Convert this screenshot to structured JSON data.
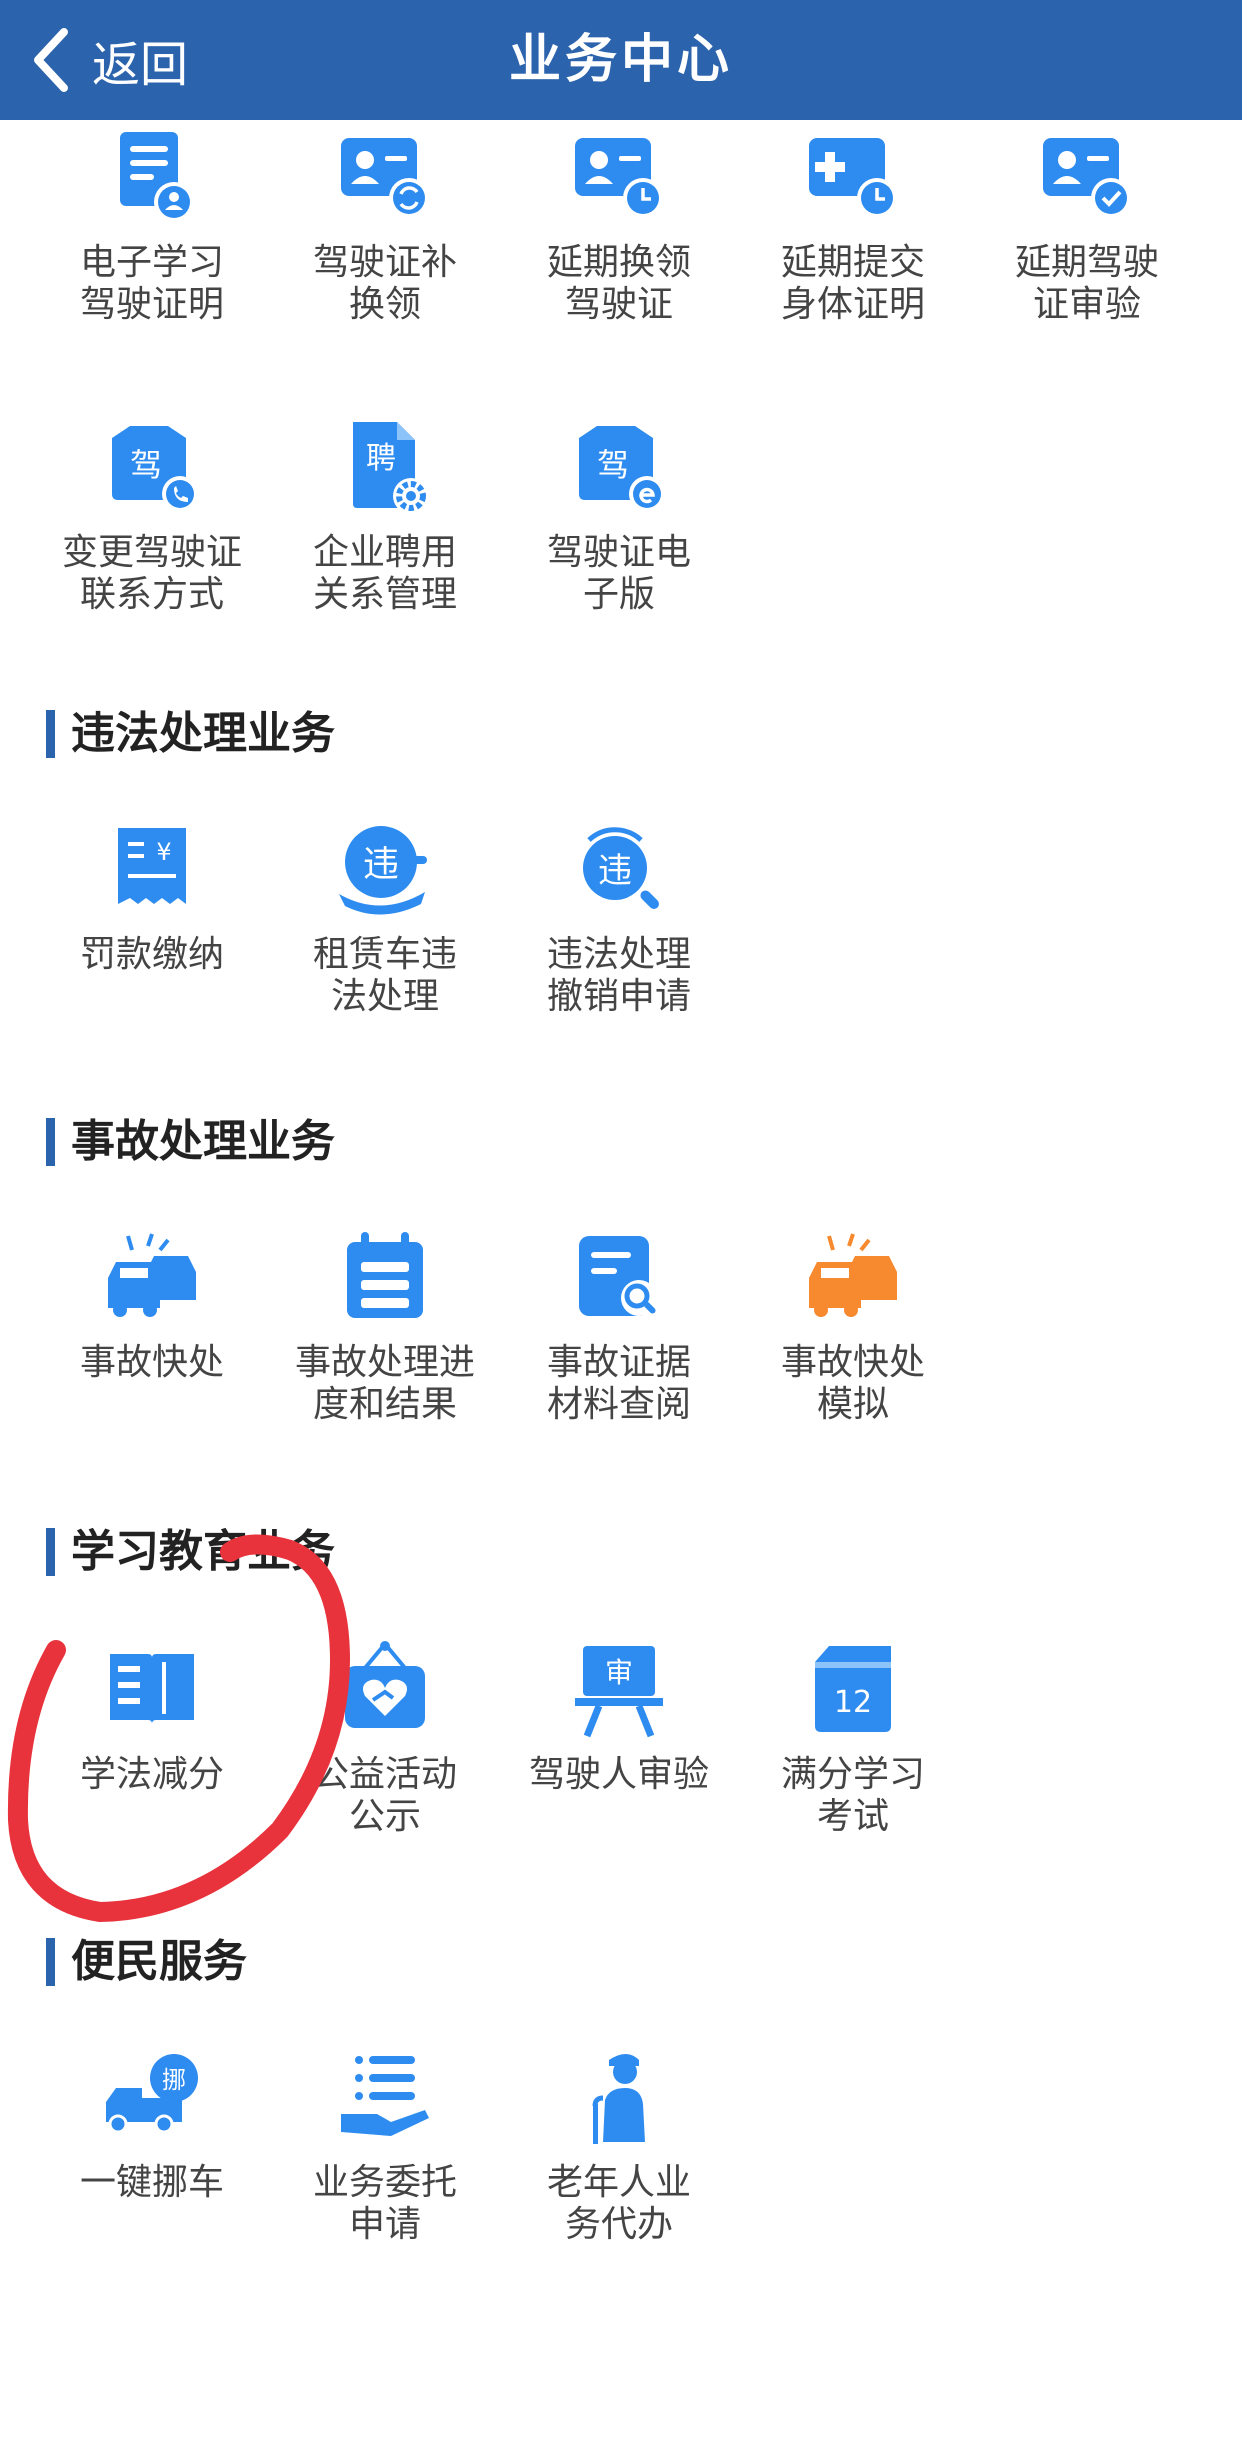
{
  "header": {
    "back_label": "返回",
    "title": "业务中心"
  },
  "sections": {
    "license": {
      "items": [
        {
          "label": "电子学习\n驾驶证明",
          "icon": "document-user-icon"
        },
        {
          "label": "驾驶证补\n换领",
          "icon": "id-card-swap-icon"
        },
        {
          "label": "延期换领\n驾驶证",
          "icon": "id-card-clock-icon"
        },
        {
          "label": "延期提交\n身体证明",
          "icon": "medical-clock-icon"
        },
        {
          "label": "延期驾驶\n证审验",
          "icon": "id-card-check-icon"
        },
        {
          "label": "变更驾驶证\n联系方式",
          "icon": "license-phone-icon",
          "glyph": "驾"
        },
        {
          "label": "企业聘用\n关系管理",
          "icon": "employ-document-icon",
          "glyph": "聘"
        },
        {
          "label": "驾驶证电\n子版",
          "icon": "license-electronic-icon",
          "glyph": "驾"
        }
      ]
    },
    "violation": {
      "title": "违法处理业务",
      "items": [
        {
          "label": "罚款缴纳",
          "icon": "fine-receipt-icon"
        },
        {
          "label": "租赁车违\n法处理",
          "icon": "rental-violation-icon",
          "glyph": "违"
        },
        {
          "label": "违法处理\n撤销申请",
          "icon": "violation-search-icon",
          "glyph": "违"
        }
      ]
    },
    "accident": {
      "title": "事故处理业务",
      "items": [
        {
          "label": "事故快处",
          "icon": "car-accident-icon"
        },
        {
          "label": "事故处理进\n度和结果",
          "icon": "calendar-list-icon"
        },
        {
          "label": "事故证据\n材料查阅",
          "icon": "document-search-icon"
        },
        {
          "label": "事故快处\n模拟",
          "icon": "car-accident-orange-icon"
        }
      ]
    },
    "education": {
      "title": "学习教育业务",
      "items": [
        {
          "label": "学法减分",
          "icon": "open-book-icon"
        },
        {
          "label": "公益活动\n公示",
          "icon": "heart-hand-sign-icon"
        },
        {
          "label": "驾驶人审验",
          "icon": "review-board-icon",
          "glyph": "审"
        },
        {
          "label": "满分学习\n考试",
          "icon": "calendar-12-icon",
          "glyph": "12"
        }
      ]
    },
    "convenience": {
      "title": "便民服务",
      "items": [
        {
          "label": "一键挪车",
          "icon": "tow-truck-icon",
          "glyph": "挪"
        },
        {
          "label": "业务委托\n申请",
          "icon": "delegate-hand-icon"
        },
        {
          "label": "老年人业\n务代办",
          "icon": "elderly-person-icon"
        }
      ]
    }
  },
  "colors": {
    "brand": "#2c63ad",
    "icon_blue": "#2e8cf0",
    "accent_orange": "#f7892f",
    "annotation_red": "#e8333c"
  }
}
